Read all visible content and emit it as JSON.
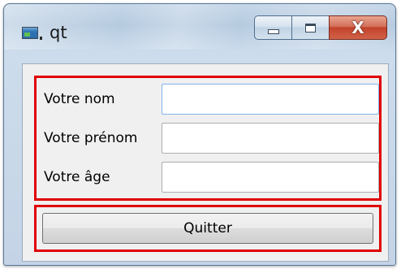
{
  "window": {
    "title": "qt",
    "icon": "qt-window-icon",
    "buttons": {
      "minimize": "minimize-icon",
      "maximize": "maximize-icon",
      "close": "close-icon",
      "close_glyph": "X"
    }
  },
  "form": {
    "fields": [
      {
        "label": "Votre nom",
        "value": "",
        "focused": true
      },
      {
        "label": "Votre prénom",
        "value": ""
      },
      {
        "label": "Votre âge",
        "value": ""
      }
    ]
  },
  "actions": {
    "quit_label": "Quitter"
  },
  "colors": {
    "highlight_border": "#e00000",
    "close_button": "#c2432a"
  }
}
